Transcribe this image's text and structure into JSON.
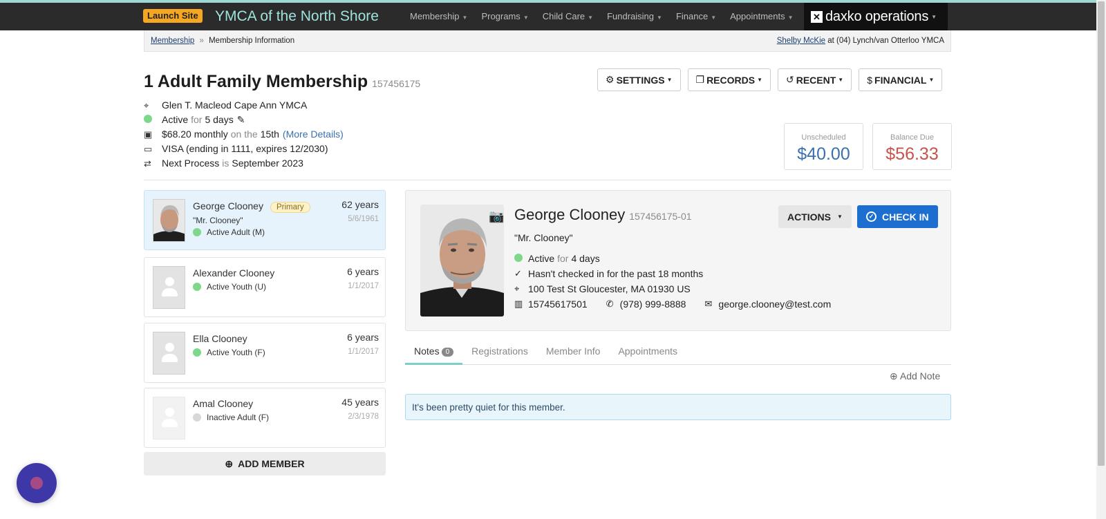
{
  "nav": {
    "launch_label": "Launch Site",
    "org_name": "YMCA of the North Shore",
    "menu": [
      "Membership",
      "Programs",
      "Child Care",
      "Fundraising",
      "Finance",
      "Appointments"
    ],
    "brand": "daxko operations"
  },
  "breadcrumb": {
    "root": "Membership",
    "separator": "»",
    "current": "Membership Information",
    "user": "Shelby McKie",
    "location_text": "at (04) Lynch/van Otterloo YMCA"
  },
  "membership": {
    "title": "1 Adult Family Membership",
    "number": "157456175",
    "branch": "Glen T. Macleod Cape Ann YMCA",
    "status": "Active",
    "status_for": "for",
    "status_duration": "5 days",
    "amount": "$68.20 monthly",
    "on_the": "on the",
    "day": "15th",
    "details_link": "(More Details)",
    "card": "VISA (ending in 1111, expires 12/2030)",
    "next_process_label": "Next Process",
    "next_process_is": "is",
    "next_process_value": "September 2023"
  },
  "header_buttons": [
    "SETTINGS",
    "RECORDS",
    "RECENT",
    "FINANCIAL"
  ],
  "balances": {
    "unscheduled_label": "Unscheduled",
    "unscheduled_value": "$40.00",
    "due_label": "Balance Due",
    "due_value": "$56.33"
  },
  "members": [
    {
      "name": "George Clooney",
      "badge": "Primary",
      "nickname": "\"Mr. Clooney\"",
      "status": "Active Adult (M)",
      "age": "62 years",
      "dob": "5/6/1961"
    },
    {
      "name": "Alexander Clooney",
      "status": "Active Youth (U)",
      "age": "6 years",
      "dob": "1/1/2017"
    },
    {
      "name": "Ella Clooney",
      "status": "Active Youth (F)",
      "age": "6 years",
      "dob": "1/1/2017"
    },
    {
      "name": "Amal Clooney",
      "status": "Inactive Adult (F)",
      "age": "45 years",
      "dob": "2/3/1978"
    }
  ],
  "add_member_label": "ADD MEMBER",
  "person": {
    "name": "George Clooney",
    "id": "157456175-01",
    "nickname": "\"Mr. Clooney\"",
    "status": "Active",
    "status_for": "for",
    "status_duration": "4 days",
    "checkin_note": "Hasn't checked in for the past 18 months",
    "address": "100 Test St Gloucester, MA 01930 US",
    "barcode": "15745617501",
    "phone": "(978) 999-8888",
    "email": "george.clooney@test.com",
    "actions_label": "ACTIONS",
    "checkin_label": "CHECK IN"
  },
  "tabs": [
    {
      "label": "Notes",
      "count": "0"
    },
    {
      "label": "Registrations"
    },
    {
      "label": "Member Info"
    },
    {
      "label": "Appointments"
    }
  ],
  "add_note_label": "Add Note",
  "empty_message": "It's been pretty quiet for this member.",
  "colors": {
    "accent_teal": "#9ee3dc",
    "launch_orange": "#f5a623",
    "checkin_blue": "#1c6fd0",
    "status_green": "#7dd88a",
    "balance_red": "#c9524b"
  }
}
